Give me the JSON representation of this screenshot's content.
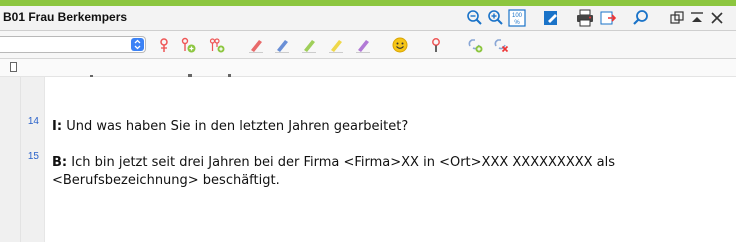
{
  "window": {
    "title": "B01 Frau Berkempers"
  },
  "titlebar_icons": [
    "zoom-out-icon",
    "zoom-in-icon",
    "zoom-100-icon",
    "edit-icon",
    "print-icon",
    "export-icon",
    "search-icon",
    "restore-window-icon",
    "collapse-icon",
    "close-icon"
  ],
  "titlebar_icon_text": {
    "zoom_100": "100"
  },
  "toolbar": {
    "code_select": {
      "value": ""
    },
    "icons": [
      "code-pin-icon",
      "code-add-icon",
      "code-multi-add-icon",
      "highlighter-red-icon",
      "highlighter-blue-icon",
      "highlighter-green-icon",
      "highlighter-yellow-icon",
      "highlighter-purple-icon",
      "emoticon-icon",
      "symbol-pin-icon",
      "link-add-icon",
      "link-remove-icon"
    ]
  },
  "paragraphs": [
    {
      "number": "14",
      "speaker": "I:",
      "lines": [
        "Und was haben Sie in den letzten Jahren gearbeitet?"
      ]
    },
    {
      "number": "15",
      "speaker": "B:",
      "lines": [
        "Ich bin jetzt seit drei Jahren bei der Firma <Firma>XX in <Ort>XXX XXXXXXXXX als",
        "<Berufsbezeichnung> beschäftigt."
      ]
    }
  ],
  "colors": {
    "accent": "#8cc63f",
    "line_number": "#2a62c9",
    "toolbar_blue": "#1a73c8"
  }
}
